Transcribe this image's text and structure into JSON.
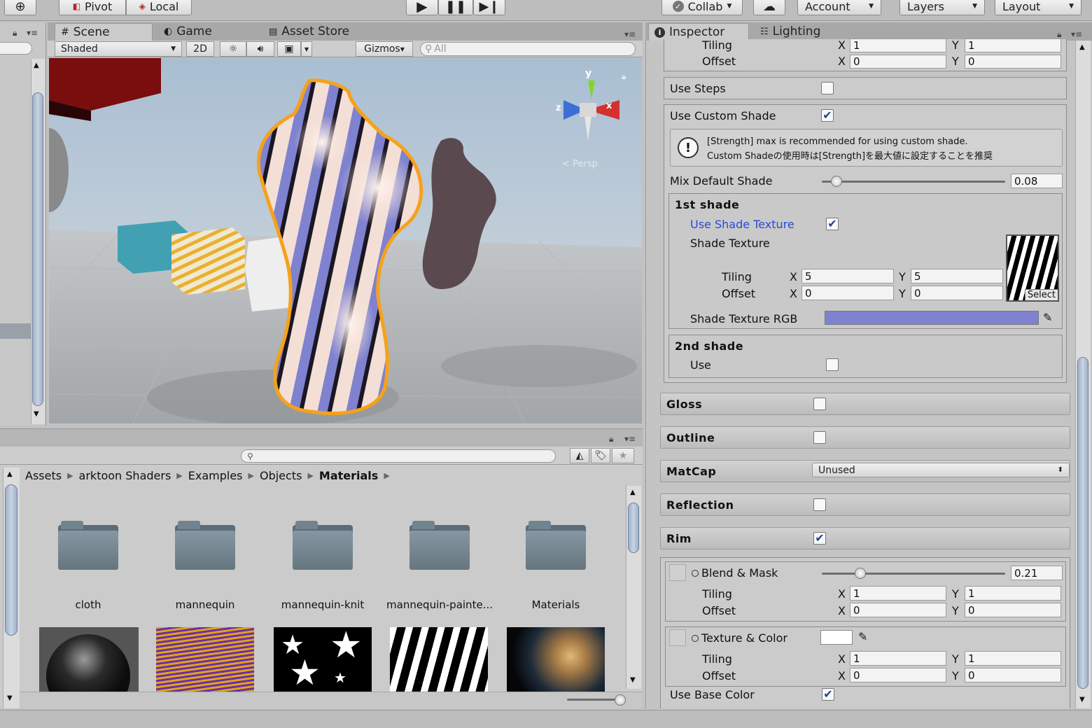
{
  "toolbar": {
    "pivot": "Pivot",
    "local": "Local",
    "collab": "Collab",
    "account": "Account",
    "layers": "Layers",
    "layout": "Layout"
  },
  "scene": {
    "tabs": [
      "Scene",
      "Game",
      "Asset Store"
    ],
    "shading_mode": "Shaded",
    "btn_2d": "2D",
    "gizmos": "Gizmos",
    "search_placeholder": "All",
    "gizmo_axes": {
      "y": "y",
      "z": "z",
      "x": "x"
    },
    "persp_label": "< Persp"
  },
  "project": {
    "breadcrumb": [
      "Assets",
      "arktoon Shaders",
      "Examples",
      "Objects",
      "Materials"
    ],
    "folders": [
      "cloth",
      "mannequin",
      "mannequin-knit",
      "mannequin-painte...",
      "Materials"
    ]
  },
  "inspector": {
    "tabs": [
      "Inspector",
      "Lighting"
    ],
    "top_tiling": {
      "label": "Tiling",
      "x": "1",
      "y": "1"
    },
    "top_offset": {
      "label": "Offset",
      "x": "0",
      "y": "0"
    },
    "use_steps": {
      "label": "Use Steps",
      "checked": false
    },
    "use_custom_shade": {
      "label": "Use Custom Shade",
      "checked": true
    },
    "help_line1": "[Strength] max is recommended for using custom shade.",
    "help_line2": "Custom Shadeの使用時は[Strength]を最大値に設定することを推奨",
    "mix_default_shade": {
      "label": "Mix Default Shade",
      "value": "0.08",
      "fraction": 0.08
    },
    "first_shade": {
      "title": "1st shade",
      "use_shade_texture": {
        "label": "Use Shade Texture",
        "checked": true
      },
      "shade_texture_label": "Shade Texture",
      "tiling": {
        "label": "Tiling",
        "x": "5",
        "y": "5"
      },
      "offset": {
        "label": "Offset",
        "x": "0",
        "y": "0"
      },
      "select": "Select",
      "rgb_label": "Shade Texture RGB",
      "rgb_color": "#7f82cf"
    },
    "second_shade": {
      "title": "2nd shade",
      "use_label": "Use",
      "checked": false
    },
    "sections": {
      "gloss": {
        "label": "Gloss",
        "checked": false
      },
      "outline": {
        "label": "Outline",
        "checked": false
      },
      "matcap": {
        "label": "MatCap",
        "value": "Unused"
      },
      "reflection": {
        "label": "Reflection",
        "checked": false
      },
      "rim": {
        "label": "Rim",
        "checked": true
      }
    },
    "blend_mask": {
      "label": "Blend & Mask",
      "value": "0.21",
      "fraction": 0.21,
      "tiling": {
        "label": "Tiling",
        "x": "1",
        "y": "1"
      },
      "offset": {
        "label": "Offset",
        "x": "0",
        "y": "0"
      }
    },
    "texture_color": {
      "label": "Texture & Color",
      "tiling": {
        "label": "Tiling",
        "x": "1",
        "y": "1"
      },
      "offset": {
        "label": "Offset",
        "x": "0",
        "y": "0"
      }
    },
    "use_base_color": {
      "label": "Use Base Color",
      "checked": true
    },
    "axis_x": "X",
    "axis_y": "Y"
  },
  "colors": {
    "selection_outline": "#f5a21b",
    "link_blue": "#2b49d6"
  }
}
